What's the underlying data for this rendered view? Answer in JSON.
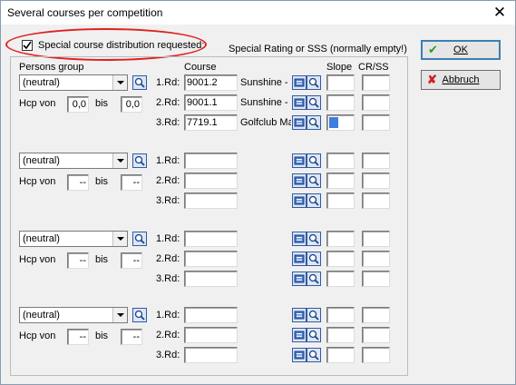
{
  "window": {
    "title": "Several courses per competition"
  },
  "special": {
    "checkbox_label": "Special course distribution requested:",
    "checked": true,
    "rating_header": "Special Rating or SSS (normally empty!)"
  },
  "headers": {
    "persons_group": "Persons group",
    "course": "Course",
    "slope": "Slope",
    "crss": "CR/SS"
  },
  "labels": {
    "hcp_von": "Hcp von",
    "bis": "bis"
  },
  "buttons": {
    "ok": "OK",
    "cancel": "Abbruch"
  },
  "groups": [
    {
      "person_group": "(neutral)",
      "hcp_from": "0,0",
      "hcp_to": "0,0",
      "rounds": [
        {
          "label": "1.Rd:",
          "course": "9001.2",
          "course_name": "Sunshine - (",
          "slope": "",
          "cr": ""
        },
        {
          "label": "2.Rd:",
          "course": "9001.1",
          "course_name": "Sunshine - (",
          "slope": "",
          "cr": ""
        },
        {
          "label": "3.Rd:",
          "course": "7719.1",
          "course_name": "Golfclub Ma",
          "slope": "",
          "cr": ""
        }
      ]
    },
    {
      "person_group": "(neutral)",
      "hcp_from": "--",
      "hcp_to": "--",
      "rounds": [
        {
          "label": "1.Rd:",
          "course": "",
          "course_name": "",
          "slope": "",
          "cr": ""
        },
        {
          "label": "2.Rd:",
          "course": "",
          "course_name": "",
          "slope": "",
          "cr": ""
        },
        {
          "label": "3.Rd:",
          "course": "",
          "course_name": "",
          "slope": "",
          "cr": ""
        }
      ]
    },
    {
      "person_group": "(neutral)",
      "hcp_from": "--",
      "hcp_to": "--",
      "rounds": [
        {
          "label": "1.Rd:",
          "course": "",
          "course_name": "",
          "slope": "",
          "cr": ""
        },
        {
          "label": "2.Rd:",
          "course": "",
          "course_name": "",
          "slope": "",
          "cr": ""
        },
        {
          "label": "3.Rd:",
          "course": "",
          "course_name": "",
          "slope": "",
          "cr": ""
        }
      ]
    },
    {
      "person_group": "(neutral)",
      "hcp_from": "--",
      "hcp_to": "--",
      "rounds": [
        {
          "label": "1.Rd:",
          "course": "",
          "course_name": "",
          "slope": "",
          "cr": ""
        },
        {
          "label": "2.Rd:",
          "course": "",
          "course_name": "",
          "slope": "",
          "cr": ""
        },
        {
          "label": "3.Rd:",
          "course": "",
          "course_name": "",
          "slope": "",
          "cr": ""
        }
      ]
    }
  ],
  "colors": {
    "focus_caret": "#3c7fdd",
    "highlight_oval": "#e02020",
    "ok_check": "#2a9a2a",
    "cancel_x": "#d02020"
  }
}
